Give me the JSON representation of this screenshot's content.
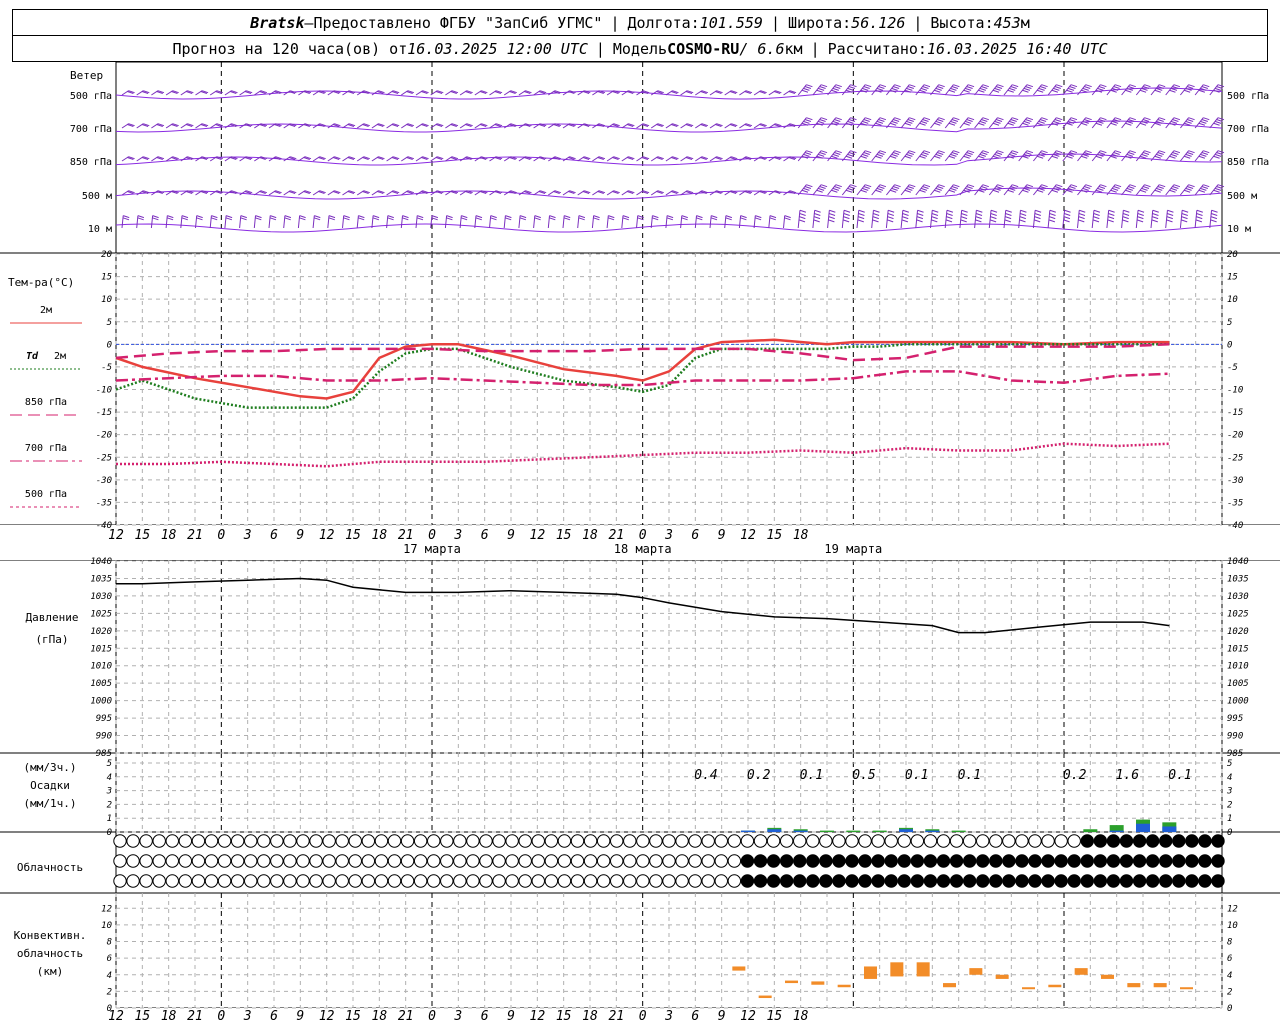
{
  "header": {
    "station": "Bratsk",
    "dash": "—",
    "provided": "Предоставлено ФГБУ \"ЗапСиб УГМС\"",
    "lon_label": "Долгота:",
    "lon_value": "101.559",
    "lat_label": "Широта:",
    "lat_value": "56.126",
    "alt_label": "Высота:",
    "alt_value": "453",
    "alt_unit": "м",
    "forecast_label": "Прогноз на 120 часа(ов) от",
    "forecast_time": "16.03.2025 12:00 UTC",
    "model_label": "Модель",
    "model_name": "COSMO-RU",
    "model_res": "/ 6.6",
    "model_res_unit": "км",
    "computed_label": "Рассчитано:",
    "computed_time": "16.03.2025 16:40 UTC"
  },
  "chart_data": [
    {
      "panel": "wind",
      "type": "barbs",
      "title": "Ветер",
      "levels": [
        "500 гПа",
        "700 гПа",
        "850 гПа",
        "500 м",
        "10 м"
      ],
      "barb_color": "#7b2fbe",
      "line_color": "#8a2be2"
    },
    {
      "panel": "temperature",
      "type": "line",
      "title": "Тем-ра(°C)",
      "y_ticks": [
        20,
        15,
        10,
        5,
        0,
        -5,
        -10,
        -15,
        -20,
        -25,
        -30,
        -35,
        -40
      ],
      "ylim": [
        -40,
        20
      ],
      "x_unit": "hours from 16.03.2025 12 UTC",
      "series": [
        {
          "name": "2м",
          "color": "#e8413c",
          "dash": "solid",
          "x": [
            0,
            3,
            9,
            15,
            21,
            24,
            27,
            30,
            33,
            36,
            39,
            45,
            51,
            57,
            60,
            63,
            66,
            69,
            75,
            81,
            84,
            87,
            90,
            96,
            102,
            108,
            114,
            120
          ],
          "values": [
            -3,
            -5,
            -7.5,
            -9.5,
            -11.5,
            -12,
            -10.5,
            -3,
            -0.5,
            0,
            0,
            -2.5,
            -5.5,
            -7,
            -8,
            -6,
            -1,
            0.5,
            1,
            0,
            0.5,
            0.5,
            0.5,
            0.5,
            0.5,
            0,
            0.5,
            0.5
          ]
        },
        {
          "name": "Td 2м",
          "color": "#1e7d1e",
          "dash": "dotted",
          "x": [
            0,
            3,
            9,
            15,
            21,
            24,
            27,
            30,
            33,
            36,
            39,
            45,
            51,
            57,
            60,
            63,
            66,
            69,
            75,
            81,
            84,
            87,
            90,
            96,
            102,
            108,
            114,
            120
          ],
          "values": [
            -10,
            -8,
            -12,
            -14,
            -14,
            -14,
            -12,
            -6,
            -2,
            -1,
            -1,
            -5,
            -8,
            -9.5,
            -10.5,
            -9,
            -3,
            -1,
            -1,
            -1,
            -0.5,
            -0.5,
            0,
            0,
            0,
            0,
            0,
            0
          ]
        },
        {
          "name": "850 гПа",
          "color": "#d4216e",
          "dash": "longdash",
          "x": [
            0,
            6,
            12,
            18,
            24,
            30,
            36,
            42,
            48,
            54,
            60,
            66,
            72,
            78,
            84,
            90,
            96,
            102,
            108,
            114,
            120
          ],
          "values": [
            -3,
            -2,
            -1.5,
            -1.5,
            -1,
            -1,
            -1,
            -1.5,
            -1.5,
            -1.5,
            -1,
            -1,
            -1,
            -2,
            -3.5,
            -3,
            -0.5,
            -0.5,
            -0.5,
            -0.5,
            0
          ]
        },
        {
          "name": "700 гПа",
          "color": "#d4216e",
          "dash": "dashdot",
          "x": [
            0,
            6,
            12,
            18,
            24,
            30,
            36,
            42,
            48,
            54,
            60,
            66,
            72,
            78,
            84,
            90,
            96,
            102,
            108,
            114,
            120
          ],
          "values": [
            -8,
            -7.5,
            -7,
            -7,
            -8,
            -8,
            -7.5,
            -8,
            -8.5,
            -9,
            -9,
            -8,
            -8,
            -8,
            -7.5,
            -6,
            -6,
            -8,
            -8.5,
            -7,
            -6.5
          ]
        },
        {
          "name": "500 гПа",
          "color": "#d4216e",
          "dash": "dotted",
          "x": [
            0,
            6,
            12,
            18,
            24,
            30,
            36,
            42,
            48,
            54,
            60,
            66,
            72,
            78,
            84,
            90,
            96,
            102,
            108,
            114,
            120
          ],
          "values": [
            -26.5,
            -26.5,
            -26,
            -26.5,
            -27,
            -26,
            -26,
            -26,
            -25.5,
            -25,
            -24.5,
            -24,
            -24,
            -23.5,
            -24,
            -23,
            -23.5,
            -23.5,
            -22,
            -22.5,
            -22
          ]
        }
      ],
      "x_ticks": [
        "12",
        "15",
        "18",
        "21",
        "0",
        "3",
        "6",
        "9",
        "12",
        "15",
        "18",
        "21",
        "0",
        "3",
        "6",
        "9",
        "12",
        "15",
        "18",
        "21",
        "0",
        "3",
        "6",
        "9",
        "12",
        "15",
        "18"
      ],
      "date_labels": [
        "17 марта",
        "18 марта",
        "19 марта"
      ]
    },
    {
      "panel": "pressure",
      "type": "line",
      "title": "Давление",
      "unit": "(гПа)",
      "y_ticks": [
        1040,
        1035,
        1030,
        1025,
        1020,
        1015,
        1010,
        1005,
        1000,
        995,
        990,
        985
      ],
      "ylim": [
        985,
        1040
      ],
      "series": [
        {
          "name": "",
          "color": "#000000",
          "x": [
            0,
            3,
            9,
            15,
            21,
            24,
            27,
            33,
            39,
            45,
            51,
            57,
            60,
            63,
            69,
            75,
            81,
            87,
            93,
            96,
            99,
            105,
            111,
            117,
            120
          ],
          "values": [
            1033.5,
            1033.5,
            1034,
            1034.5,
            1035,
            1034.5,
            1032.5,
            1031,
            1031,
            1031.5,
            1031,
            1030.5,
            1029.5,
            1028,
            1025.5,
            1024,
            1023.5,
            1022.5,
            1021.5,
            1019.5,
            1019.5,
            1021,
            1022.5,
            1022.5,
            1021.5
          ]
        }
      ]
    },
    {
      "panel": "precipitation",
      "type": "bar",
      "title": "Осадки",
      "unit_top": "(мм/3ч.)",
      "unit_bottom": "(мм/1ч.)",
      "y_ticks": [
        5,
        4,
        3,
        2,
        1,
        0
      ],
      "ylim": [
        0,
        5
      ],
      "amount_labels": [
        {
          "x": 72,
          "text": "0.4"
        },
        {
          "x": 78,
          "text": "0.2"
        },
        {
          "x": 84,
          "text": "0.1"
        },
        {
          "x": 90,
          "text": "0.5"
        },
        {
          "x": 96,
          "text": "0.1"
        },
        {
          "x": 102,
          "text": "0.1"
        },
        {
          "x": 114,
          "text": "0.2"
        },
        {
          "x": 120,
          "text": "1.6"
        },
        {
          "x": 126,
          "text": "0.1"
        }
      ],
      "series": [
        {
          "name": "",
          "color": "#2ca02c",
          "x": [
            72,
            75,
            78,
            81,
            84,
            87,
            90,
            93,
            96,
            111,
            114,
            117,
            120
          ],
          "values": [
            0.1,
            0.3,
            0.2,
            0.1,
            0.1,
            0.1,
            0.3,
            0.2,
            0.1,
            0.2,
            0.5,
            0.9,
            0.7
          ]
        },
        {
          "name": "",
          "color": "#1f5fd6",
          "x": [
            72,
            75,
            78,
            90,
            93,
            114,
            117,
            120
          ],
          "values": [
            0.1,
            0.2,
            0.1,
            0.2,
            0.1,
            0.1,
            0.6,
            0.4
          ]
        }
      ]
    },
    {
      "panel": "cloudiness",
      "type": "table",
      "title": "Облачность",
      "rows": [
        "upper",
        "middle",
        "lower"
      ],
      "filled_from_hour": [
        110,
        72,
        72
      ],
      "symbol_color": "#000000"
    },
    {
      "panel": "convective",
      "type": "bar",
      "title": "Конвективн. облачность (км)",
      "title_lines": [
        "Конвективн.",
        "облачность",
        "(км)"
      ],
      "y_ticks": [
        12,
        10,
        8,
        6,
        4,
        2,
        0
      ],
      "ylim": [
        0,
        13
      ],
      "color": "#f28c28",
      "x": [
        75,
        78,
        81,
        84,
        87,
        90,
        93,
        96,
        99,
        102,
        105,
        108,
        111,
        114,
        117,
        120,
        123,
        126
      ],
      "values": [
        [
          4.5,
          5.0
        ],
        [
          1.2,
          1.5
        ],
        [
          3.0,
          3.3
        ],
        [
          2.8,
          3.2
        ],
        [
          2.5,
          2.8
        ],
        [
          3.5,
          5.0
        ],
        [
          3.8,
          5.5
        ],
        [
          3.8,
          5.5
        ],
        [
          2.5,
          3.0
        ],
        [
          4.0,
          4.8
        ],
        [
          3.5,
          4.0
        ],
        [
          2.3,
          2.5
        ],
        [
          2.5,
          2.8
        ],
        [
          4.0,
          4.8
        ],
        [
          3.5,
          4.0
        ],
        [
          2.5,
          3.0
        ],
        [
          2.5,
          3.0
        ],
        [
          2.3,
          2.5
        ]
      ]
    }
  ],
  "legend": {
    "t2m": "2м",
    "td": "Td",
    "td_level": "2м",
    "p850": "850 гПа",
    "p700": "700 гПа",
    "p500": "500 гПа"
  }
}
